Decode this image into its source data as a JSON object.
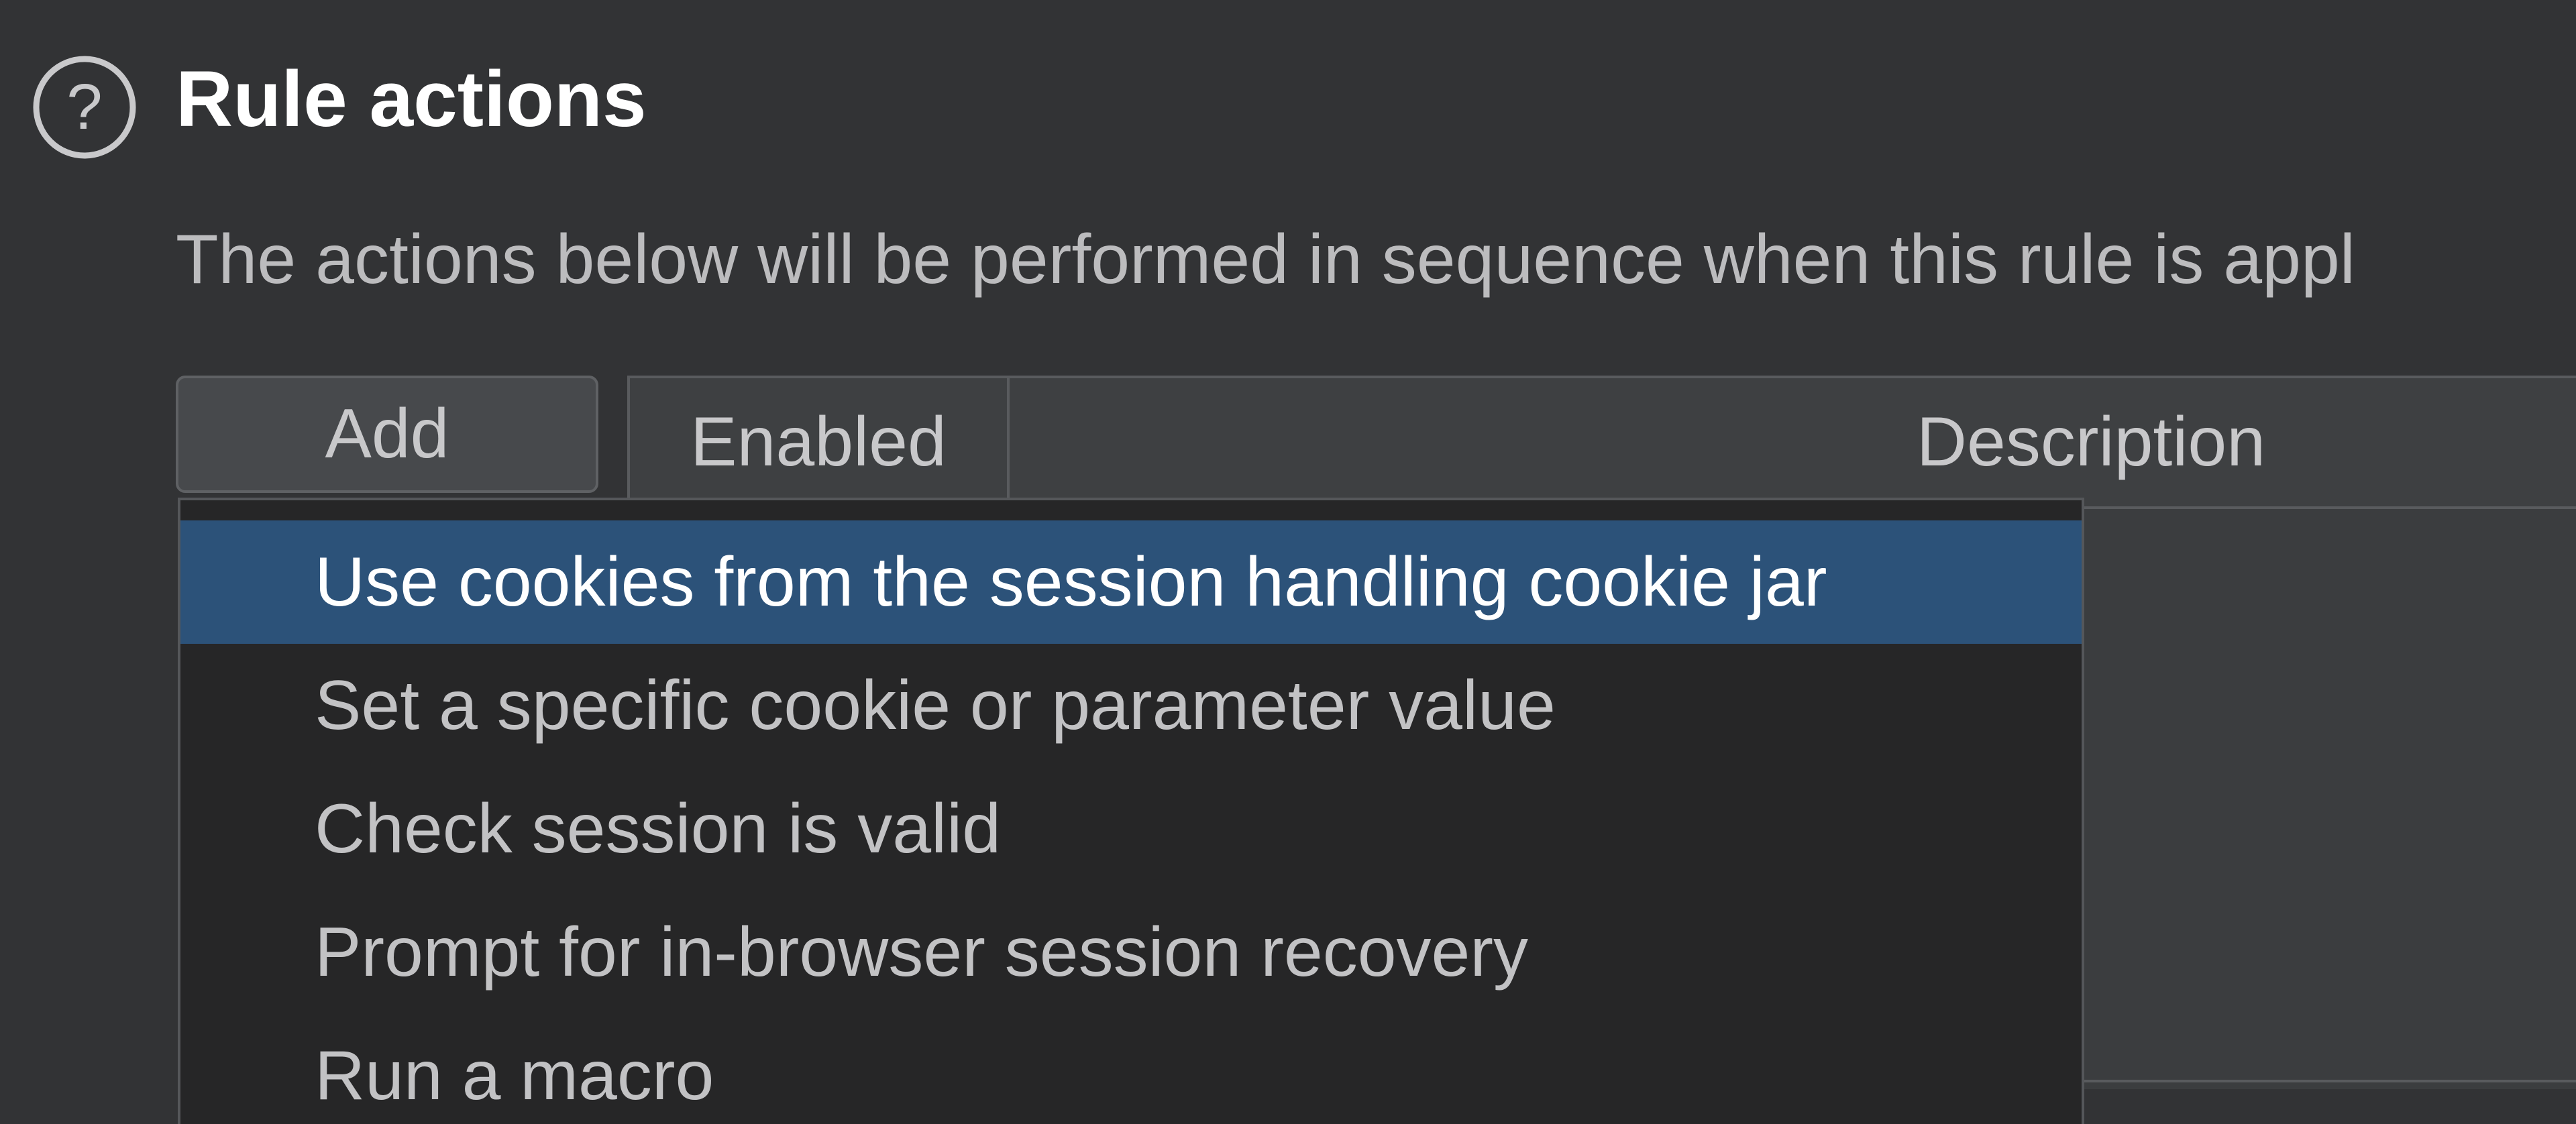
{
  "section": {
    "title": "Rule actions",
    "description": "The actions below will be performed in sequence when this rule is appl",
    "help_icon": "question-circle-icon"
  },
  "toolbar": {
    "add_label": "Add"
  },
  "table": {
    "columns": [
      "Enabled",
      "Description"
    ]
  },
  "add_menu": {
    "items": [
      {
        "label": "Use cookies from the session handling cookie jar",
        "selected": true
      },
      {
        "label": "Set a specific cookie or parameter value",
        "selected": false
      },
      {
        "label": "Check session is valid",
        "selected": false
      },
      {
        "label": "Prompt for in-browser session recovery",
        "selected": false
      },
      {
        "label": "Run a macro",
        "selected": false
      }
    ]
  },
  "colors": {
    "background": "#323335",
    "menu_background": "#262627",
    "selection": "#2c5279",
    "text": "#c2c2c4",
    "title": "#ffffff"
  }
}
